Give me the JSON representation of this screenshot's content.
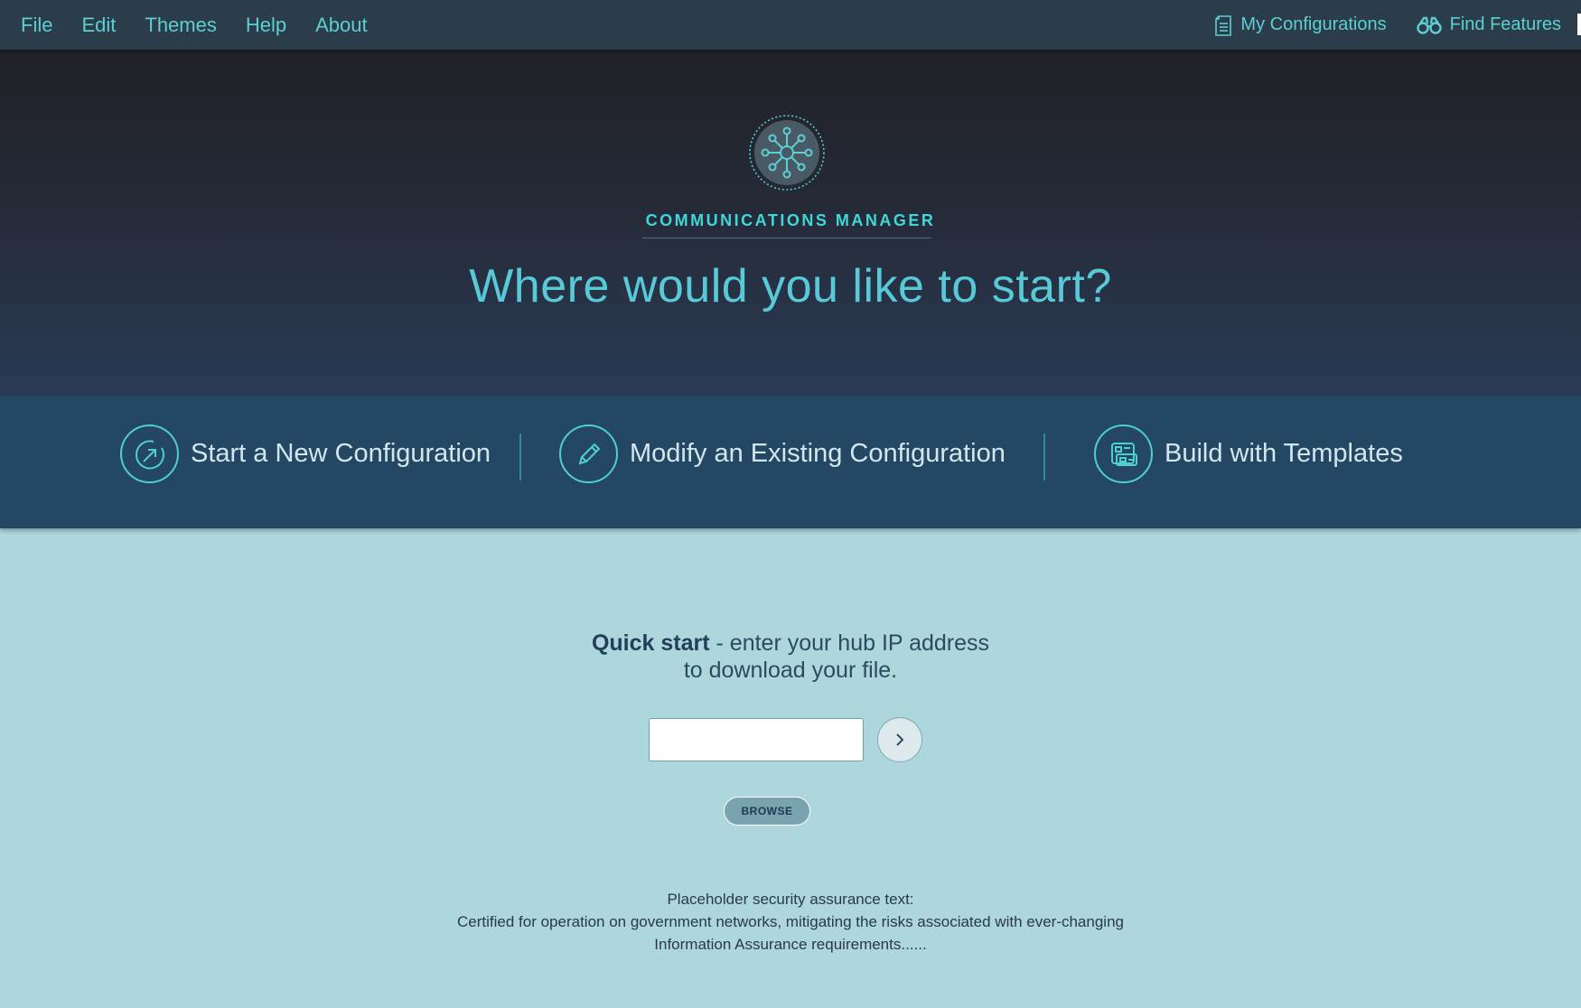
{
  "menu": {
    "items": [
      "File",
      "Edit",
      "Themes",
      "Help",
      "About"
    ]
  },
  "top_links": {
    "configurations": "My Configurations",
    "features": "Find Features"
  },
  "hero": {
    "app_title": "COMMUNICATIONS MANAGER",
    "headline": "Where would you like to start?"
  },
  "options": {
    "new": "Start a New Configuration",
    "modify": "Modify an Existing Configuration",
    "templates": "Build with Templates"
  },
  "quick_start": {
    "bold": "Quick start",
    "line1_rest": " - enter your hub IP address",
    "line2": "to download your file.",
    "ip_value": "",
    "browse_label": "BROWSE"
  },
  "security": {
    "line1": "Placeholder security assurance text:",
    "line2": "Certified for operation on government networks, mitigating the risks associated with ever-changing",
    "line3": "Information Assurance requirements......"
  },
  "colors": {
    "accent": "#5ccfd3",
    "topbar": "#2b3c4b",
    "options_bar": "#244863",
    "lower_bg": "#aed6dd"
  }
}
